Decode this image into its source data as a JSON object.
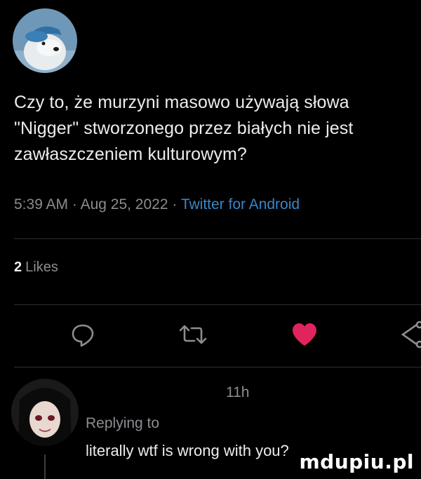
{
  "tweet": {
    "text": "Czy to, że murzyni masowo używają słowa \"Nigger\" stworzonego przez białych nie jest zawłaszczeniem kulturowym?",
    "time": "5:39 AM",
    "date": "Aug 25, 2022",
    "source": "Twitter for Android",
    "separator": " · ",
    "likes_count": "2",
    "likes_label": "Likes"
  },
  "actions": {
    "reply_icon": "reply-bubble-icon",
    "retweet_icon": "retweet-icon",
    "like_icon": "heart-filled-icon",
    "share_icon": "share-icon",
    "like_color": "#e0245e",
    "icon_color": "#8a8d91"
  },
  "reply": {
    "age": "11h",
    "replying_to": "Replying to",
    "text": "literally wtf is wrong with you?"
  },
  "watermark": "mdupiu.pl"
}
